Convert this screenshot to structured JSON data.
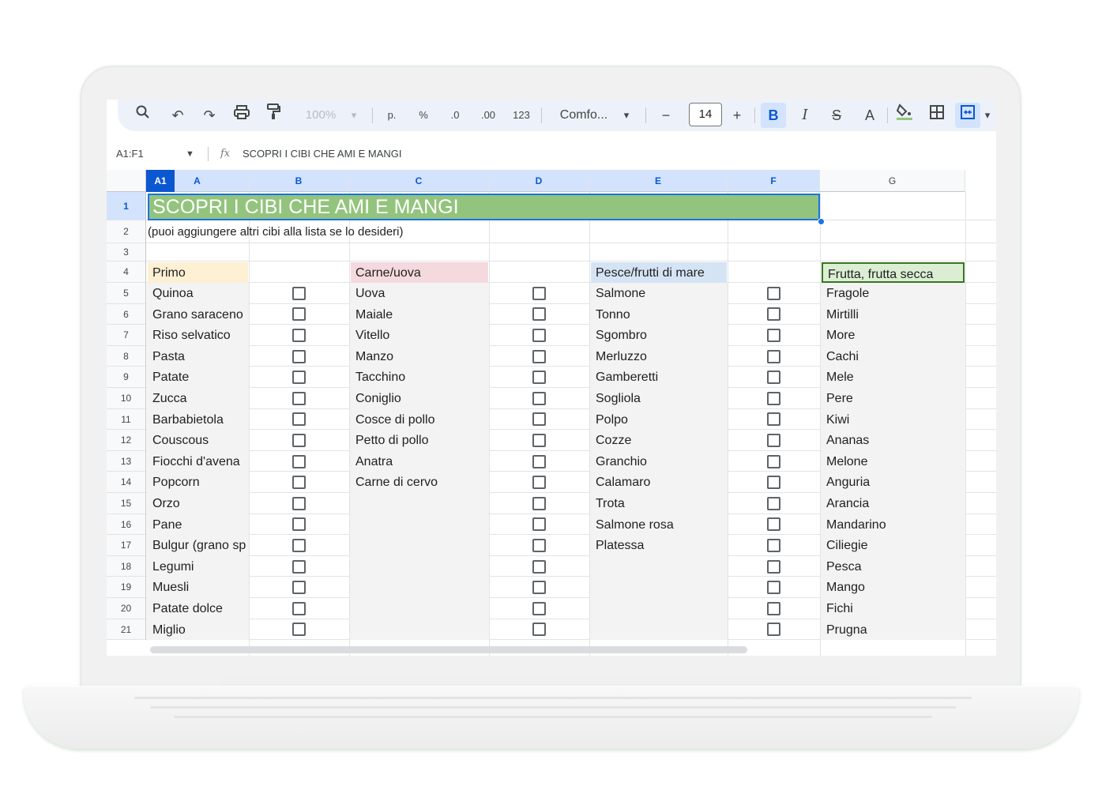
{
  "toolbar": {
    "zoom": "100%",
    "format_currency": "p.",
    "format_percent": "%",
    "decimal_decrease": ".0",
    "decimal_increase": ".00",
    "format_number": "123",
    "font_name": "Comfo...",
    "font_size": "14",
    "minus": "−",
    "plus": "+",
    "bold": "B",
    "italic": "I",
    "strike": "S",
    "text_color": "A"
  },
  "formula_bar": {
    "name_box": "A1:F1",
    "fx": "fx",
    "value": "SCOPRI I CIBI CHE AMI E MANGI"
  },
  "grid": {
    "selected_badge": "A1",
    "columns": [
      "A",
      "B",
      "C",
      "D",
      "E",
      "F",
      "G"
    ],
    "rows": [
      "1",
      "2",
      "3",
      "4",
      "5",
      "6",
      "7",
      "8",
      "9",
      "10",
      "11",
      "12",
      "13",
      "14",
      "15",
      "16",
      "17",
      "18",
      "19",
      "20",
      "21"
    ]
  },
  "sheet": {
    "title": "SCOPRI I CIBI CHE AMI E MANGI",
    "subtitle": "(puoi aggiungere altri cibi alla lista se lo desideri)",
    "categories": [
      {
        "header": "Primo",
        "color": "#fdf0d3",
        "items": [
          "Quinoa",
          "Grano saraceno",
          "Riso selvatico",
          "Pasta",
          "Patate",
          "Zucca",
          "Barbabietola",
          "Couscous",
          "Fiocchi d'avena",
          "Popcorn",
          "Orzo",
          "Pane",
          "Bulgur (grano sp",
          "Legumi",
          "Muesli",
          "Patate dolce",
          "Miglio"
        ],
        "checkbox_rows": 17
      },
      {
        "header": "Carne/uova",
        "color": "#f4d9de",
        "items": [
          "Uova",
          "Maiale",
          "Vitello",
          "Manzo",
          "Tacchino",
          "Coniglio",
          "Cosce di pollo",
          "Petto di pollo",
          "Anatra",
          "Carne di cervo"
        ],
        "checkbox_rows": 17
      },
      {
        "header": "Pesce/frutti di mare",
        "color": "#d5e4f5",
        "items": [
          "Salmone",
          "Tonno",
          "Sgombro",
          "Merluzzo",
          "Gamberetti",
          "Sogliola",
          "Polpo",
          "Cozze",
          "Granchio",
          "Calamaro",
          "Trota",
          "Salmone rosa",
          "Platessa"
        ],
        "checkbox_rows": 17
      },
      {
        "header": "Frutta, frutta secca",
        "color": "#dbeed3",
        "items": [
          "Fragole",
          "Mirtilli",
          "More",
          "Cachi",
          "Mele",
          "Pere",
          "Kiwi",
          "Ananas",
          "Melone",
          "Anguria",
          "Arancia",
          "Mandarino",
          "Ciliegie",
          "Pesca",
          "Mango",
          "Fichi",
          "Prugna"
        ],
        "checkbox_rows": 0
      }
    ]
  }
}
